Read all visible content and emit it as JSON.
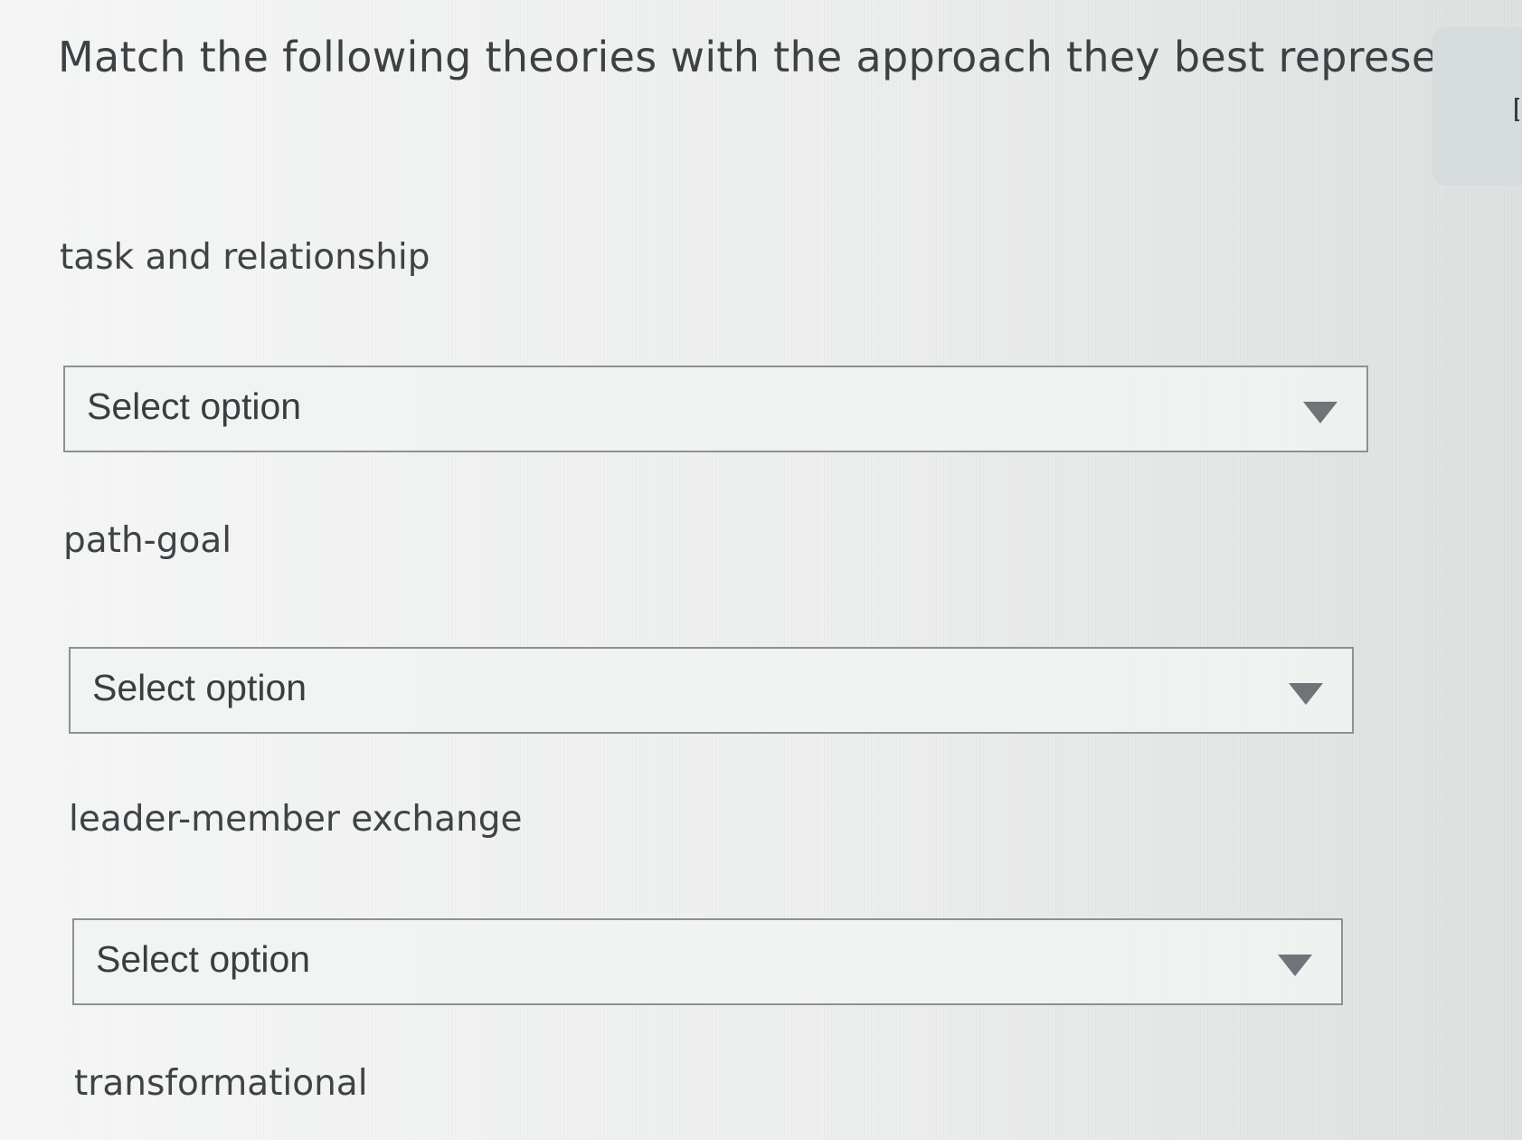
{
  "question": {
    "title": "Match the following theories with the approach they best represent."
  },
  "items": [
    {
      "label": "task and relationship",
      "select_value": "Select option"
    },
    {
      "label": "path-goal",
      "select_value": "Select option"
    },
    {
      "label": "leader-member exchange",
      "select_value": "Select option"
    },
    {
      "label": "transformational"
    }
  ],
  "icons": {
    "dropdown": "chevron-down-icon"
  },
  "colors": {
    "text": "#3f4346",
    "select_border": "#8d9194",
    "caret": "#6f7478",
    "background": "#e9ebea"
  }
}
